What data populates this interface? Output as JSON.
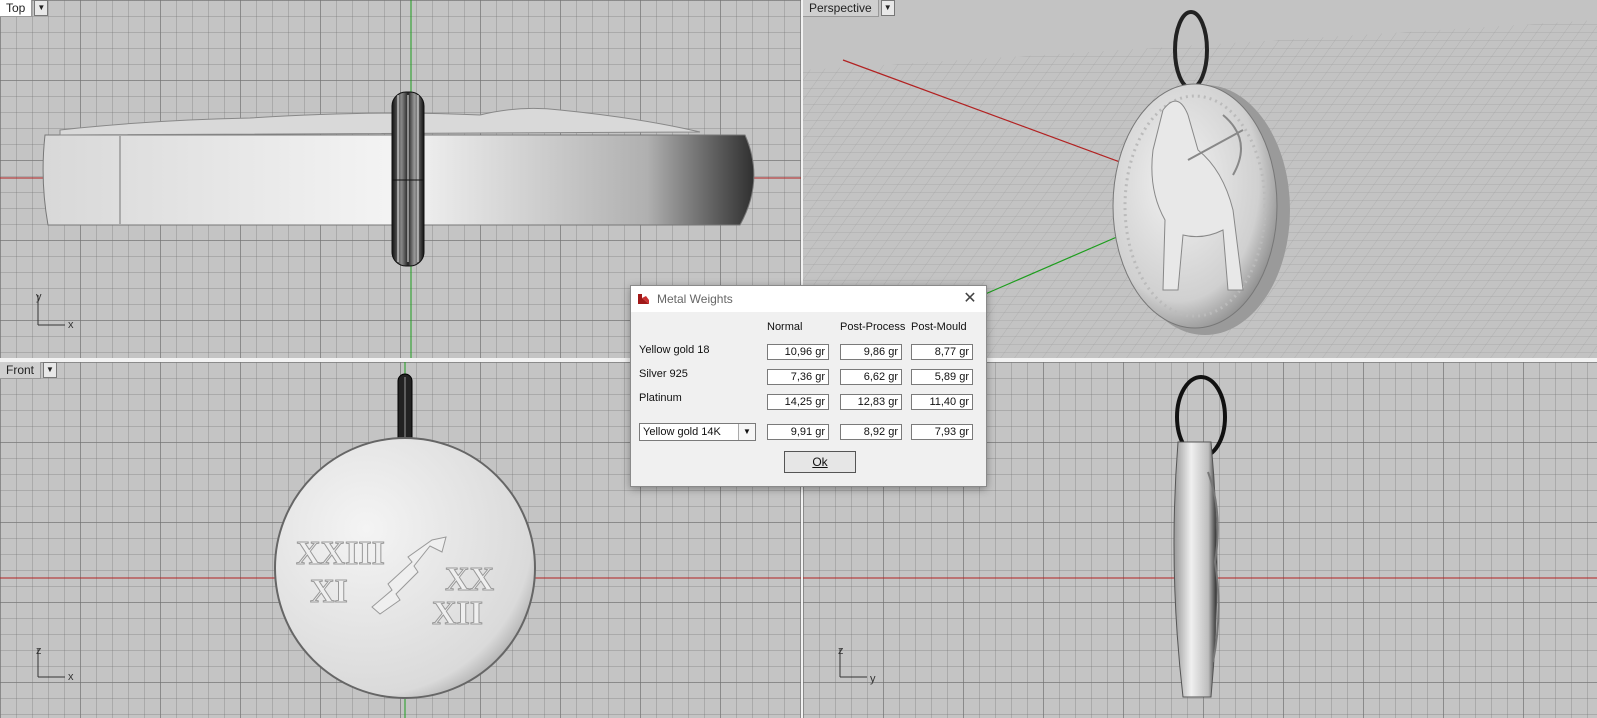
{
  "viewports": {
    "top": {
      "label": "Top"
    },
    "perspective": {
      "label": "Perspective"
    },
    "front": {
      "label": "Front"
    },
    "right": {
      "label": ""
    }
  },
  "axes": {
    "top": [
      "y",
      "x"
    ],
    "front": [
      "z",
      "x"
    ],
    "right": [
      "z",
      "y"
    ]
  },
  "pendant_text": {
    "line1": "XXIII",
    "line2": "XI",
    "line3": "XX",
    "line4": "XII"
  },
  "dialog": {
    "title": "Metal Weights",
    "close_icon": "close-icon",
    "columns": [
      "Normal",
      "Post-Process",
      "Post-Mould"
    ],
    "rows": [
      {
        "label": "Yellow gold 18",
        "values": [
          "10,96 gr",
          "9,86 gr",
          "8,77 gr"
        ]
      },
      {
        "label": "Silver 925",
        "values": [
          "7,36 gr",
          "6,62 gr",
          "5,89 gr"
        ]
      },
      {
        "label": "Platinum",
        "values": [
          "14,25 gr",
          "12,83 gr",
          "11,40 gr"
        ]
      }
    ],
    "custom": {
      "selected": "Yellow gold 14K",
      "values": [
        "9,91 gr",
        "8,92 gr",
        "7,93 gr"
      ]
    },
    "ok_label": "Ok"
  },
  "colors": {
    "x_axis": "#b22222",
    "y_axis": "#1e9e1e",
    "dialog_icon": "#a01818"
  }
}
